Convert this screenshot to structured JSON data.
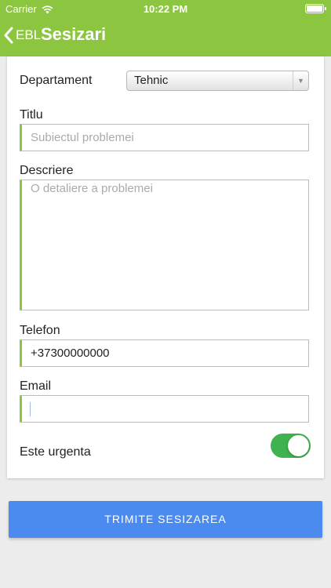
{
  "status_bar": {
    "carrier": "Carrier",
    "time": "10:22 PM",
    "battery_level": 1.0
  },
  "nav": {
    "back_label": "EBL",
    "title": "Sesizari"
  },
  "form": {
    "departament": {
      "label": "Departament",
      "value": "Tehnic"
    },
    "titlu": {
      "label": "Titlu",
      "placeholder": "Subiectul problemei"
    },
    "descriere": {
      "label": "Descriere",
      "placeholder": "O detaliere a problemei"
    },
    "telefon": {
      "label": "Telefon",
      "value": "+37300000000"
    },
    "email": {
      "label": "Email",
      "value": ""
    },
    "urgent": {
      "label": "Este urgenta",
      "on": true
    }
  },
  "submit_label": "TRIMITE SESIZAREA",
  "colors": {
    "accent": "#8cc53f",
    "button": "#4b8bf0",
    "toggle_on": "#3fb34f"
  }
}
